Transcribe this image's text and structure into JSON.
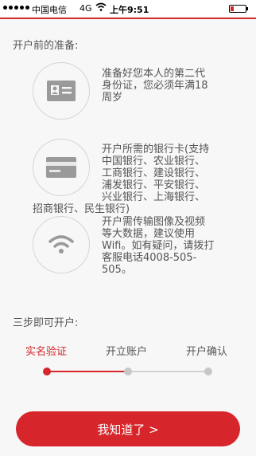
{
  "status_bar": {
    "carrier": "中国电信",
    "network": "4G",
    "time": "上午9:51"
  },
  "prep": {
    "title": "开户前的准备:",
    "items": [
      {
        "icon": "id-card-icon",
        "lines": [
          "准备好您本人的第二代",
          "身份证，您必须年满18",
          "周岁"
        ]
      },
      {
        "icon": "bank-card-icon",
        "lines": [
          "开户所需的银行卡(支持",
          "中国银行、农业银行、",
          "工商银行、建设银行、",
          "浦发银行、平安银行、",
          "兴业银行、上海银行、"
        ],
        "extra_line": "招商银行、民生银行)"
      },
      {
        "icon": "wifi-icon",
        "lines": [
          "开户需传输图像及视频",
          "等大数据，建议使用",
          "Wifi。如有疑问，请拨打",
          "客服电话4008-505-",
          "505。"
        ]
      }
    ]
  },
  "steps": {
    "title": "三步即可开户:",
    "labels": [
      "实名验证",
      "开立账户",
      "开户确认"
    ],
    "active_index": 0
  },
  "cta": {
    "label": "我知道了 >"
  },
  "colors": {
    "accent": "#d6262b",
    "inactive": "#c7c7c7"
  }
}
